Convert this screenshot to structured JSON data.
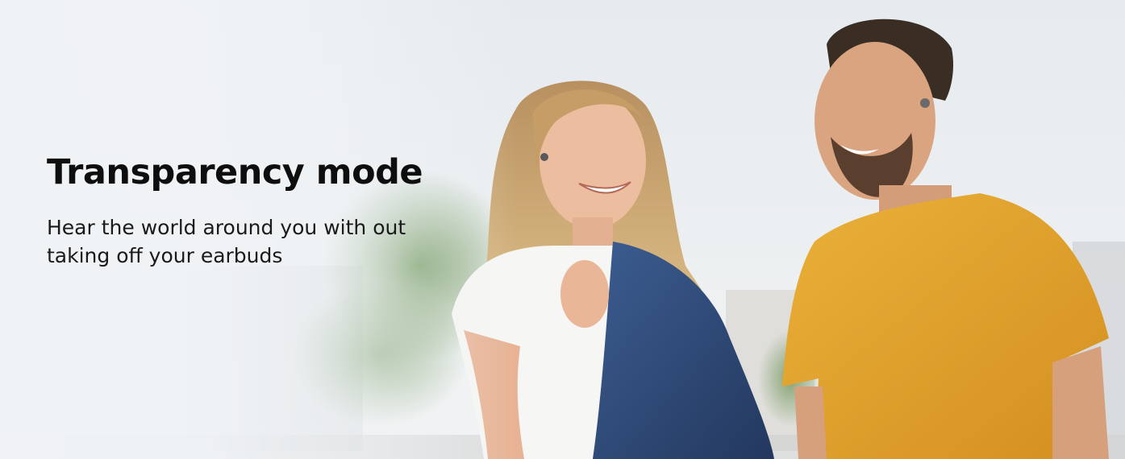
{
  "hero": {
    "headline": "Transparency mode",
    "subtext": "Hear the world around you with out taking off your earbuds"
  },
  "palette": {
    "sky": "#e9eef2",
    "foliage": "#4f7a3e",
    "jacket": "#2f4a78",
    "tshirt_yellow": "#e3a12a",
    "white_top": "#f4f4f2",
    "hair_blonde": "#c9a46b",
    "skin": "#e8b99a"
  }
}
